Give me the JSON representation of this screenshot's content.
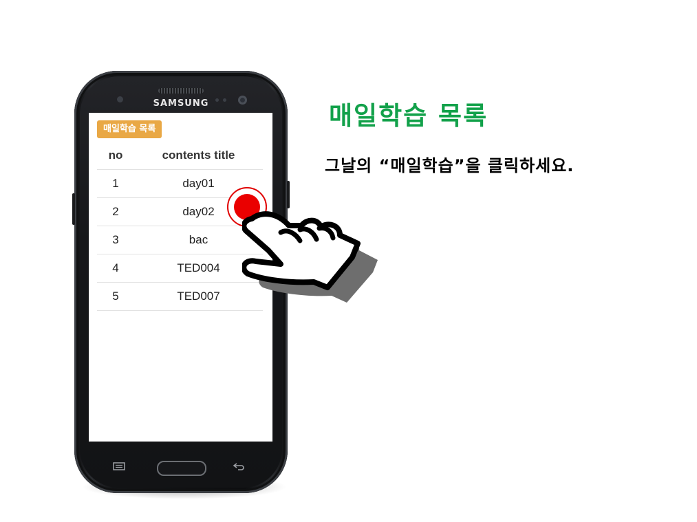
{
  "phone": {
    "brand": "SAMSUNG",
    "soft_keys": {
      "menu_icon": "menu-icon",
      "back_icon": "back-arrow-icon"
    }
  },
  "screen": {
    "badge_label": "매일학습 목록",
    "table": {
      "headers": [
        "no",
        "contents title"
      ],
      "rows": [
        {
          "no": "1",
          "title": "day01"
        },
        {
          "no": "2",
          "title": "day02"
        },
        {
          "no": "3",
          "title": "bac"
        },
        {
          "no": "4",
          "title": "TED004"
        },
        {
          "no": "5",
          "title": "TED007"
        }
      ]
    }
  },
  "instruction": {
    "title": "매일학습 목록",
    "body": "그날의 “매일학습”을 클릭하세요."
  },
  "colors": {
    "badge": "#e9a845",
    "title_green": "#12a14a",
    "tap_red": "#ea0000"
  }
}
